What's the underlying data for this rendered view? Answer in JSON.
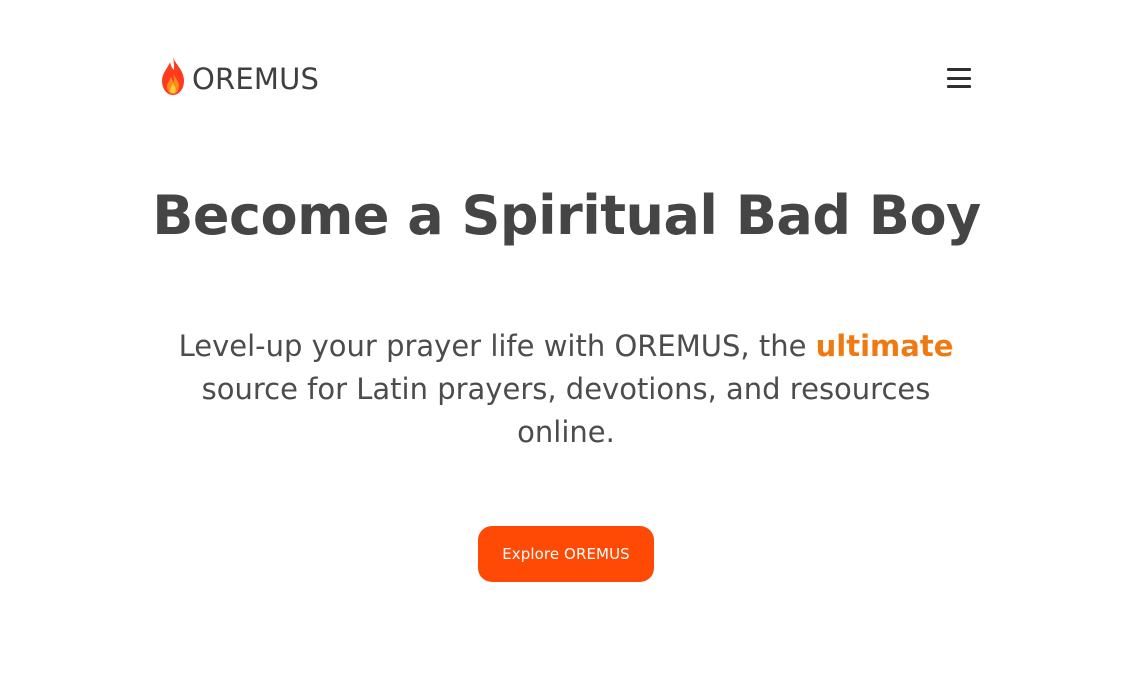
{
  "header": {
    "brand_name": "OREMUS",
    "logo_icon": "flame-icon",
    "menu_icon": "hamburger-menu-icon"
  },
  "hero": {
    "title": "Become a Spiritual Bad Boy",
    "subtitle_before": "Level-up your prayer life with OREMUS, the ",
    "subtitle_accent": "ultimate",
    "subtitle_after": " source for Latin prayers, devotions, and resources online.",
    "cta_label": "Explore OREMUS"
  },
  "colors": {
    "accent": "#f07a12",
    "cta_background": "#ff4a06",
    "text": "#454545"
  }
}
